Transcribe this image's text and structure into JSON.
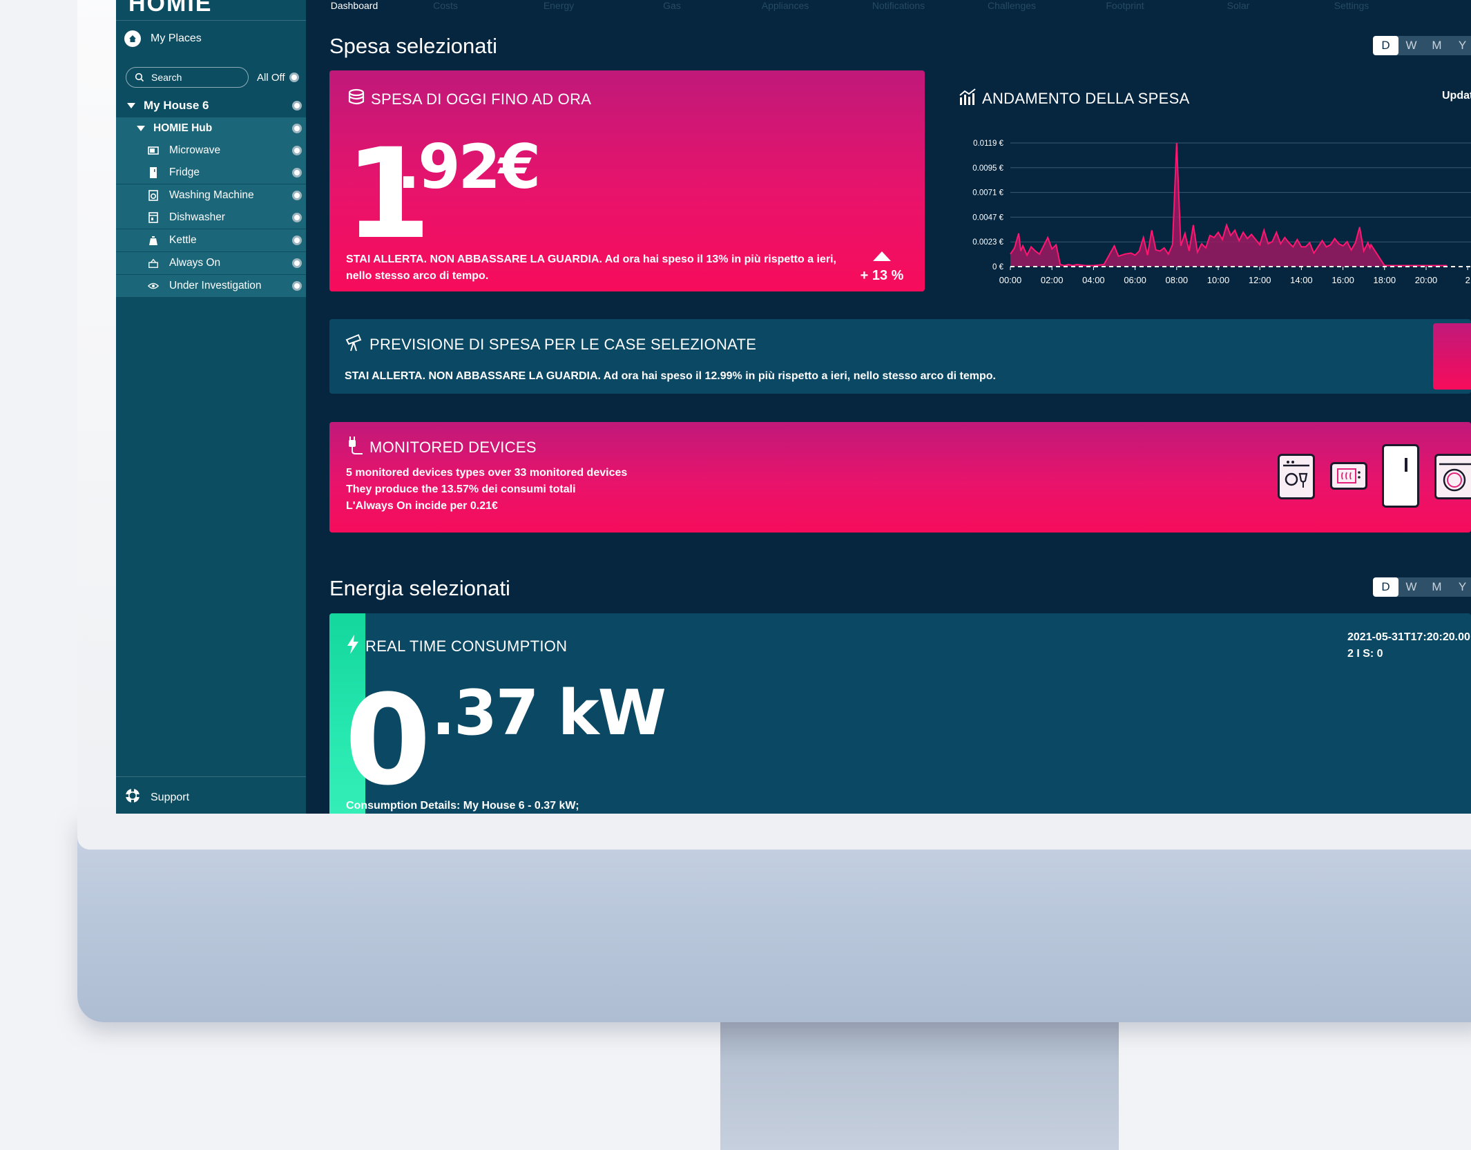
{
  "app": {
    "logo": "HOMIE"
  },
  "sidebar": {
    "my_places": "My Places",
    "search_placeholder": "Search",
    "all_off": "All Off",
    "house": "My House 6",
    "hub": "HOMIE Hub",
    "devices": [
      {
        "label": "Microwave",
        "icon": "microwave-icon"
      },
      {
        "label": "Fridge",
        "icon": "fridge-icon"
      },
      {
        "label": "Washing Machine",
        "icon": "washing-machine-icon"
      },
      {
        "label": "Dishwasher",
        "icon": "dishwasher-icon"
      },
      {
        "label": "Kettle",
        "icon": "kettle-icon"
      },
      {
        "label": "Always On",
        "icon": "always-on-icon"
      },
      {
        "label": "Under Investigation",
        "icon": "eye-icon"
      }
    ],
    "support": "Support"
  },
  "topnav": {
    "tabs": [
      "Dashboard",
      "Costs",
      "Energy",
      "Gas",
      "Appliances",
      "Notifications",
      "Challenges",
      "Footprint",
      "Solar",
      "Settings"
    ],
    "active": "Dashboard"
  },
  "spesa": {
    "section_title": "Spesa selezionati",
    "periods": [
      "D",
      "W",
      "M",
      "Y"
    ],
    "active_period": "D",
    "today": {
      "title": "SPESA DI OGGI FINO AD ORA",
      "value_int": "1",
      "value_dec": ".92€",
      "alert": "STAI ALLERTA. NON ABBASSARE LA GUARDIA. Ad ora hai speso il 13% in più rispetto a ieri, nello stesso arco di tempo.",
      "trend": "+ 13 %"
    },
    "andamento": {
      "title": "ANDAMENTO DELLA SPESA",
      "updated": "Updat"
    },
    "previsione": {
      "title": "PREVISIONE DI SPESA PER LE CASE SELEZIONATE",
      "text": "STAI ALLERTA. NON ABBASSARE LA GUARDIA. Ad ora hai speso il 12.99% in più rispetto a ieri, nello stesso arco di tempo."
    },
    "monitored": {
      "title": "MONITORED DEVICES",
      "lines": [
        "5 monitored devices types over 33 monitored devices",
        "They produce the 13.57% dei consumi totali",
        "L'Always On incide per 0.21€"
      ]
    }
  },
  "energia": {
    "section_title": "Energia selezionati",
    "periods": [
      "D",
      "W",
      "M",
      "Y"
    ],
    "active_period": "D",
    "realtime": {
      "title": "REAL TIME CONSUMPTION",
      "value_int": "0",
      "value_dec": ".37 kW",
      "timestamp": "2021-05-31T17:20:20.00",
      "status": "2 I S: 0",
      "details": "Consumption Details: My House 6 - 0.37 kW;"
    }
  },
  "colors": {
    "accent_pink": "#e8136b",
    "sidebar": "#0c4d62",
    "background": "#062640",
    "teal_card": "#0a4864"
  },
  "chart_data": {
    "type": "area",
    "title": "ANDAMENTO DELLA SPESA",
    "ytick_labels": [
      "0 €",
      "0.0023 €",
      "0.0047 €",
      "0.0071 €",
      "0.0095 €",
      "0.0119 €"
    ],
    "xtick_labels": [
      "00:00",
      "02:00",
      "04:00",
      "06:00",
      "08:00",
      "10:00",
      "12:00",
      "14:00",
      "16:00",
      "18:00",
      "20:00",
      "2"
    ],
    "ylim": [
      0,
      0.0119
    ],
    "x_hours": [
      0,
      0.2,
      0.4,
      0.5,
      0.6,
      0.8,
      1.0,
      1.2,
      1.4,
      1.6,
      1.8,
      2.0,
      2.2,
      2.4,
      2.6,
      2.8,
      3.0,
      3.2,
      3.6,
      4.0,
      4.5,
      5.0,
      5.2,
      5.5,
      5.8,
      6.0,
      6.2,
      6.4,
      6.6,
      6.8,
      7.0,
      7.2,
      7.4,
      7.6,
      7.8,
      8.0,
      8.2,
      8.4,
      8.6,
      8.8,
      9.0,
      9.2,
      9.4,
      9.6,
      9.8,
      10.0,
      10.2,
      10.4,
      10.6,
      10.8,
      11.0,
      11.2,
      11.4,
      11.6,
      11.8,
      12.0,
      12.2,
      12.4,
      12.6,
      12.8,
      13.0,
      13.2,
      13.4,
      13.6,
      13.8,
      14.0,
      14.2,
      14.4,
      14.6,
      14.8,
      15.0,
      15.2,
      15.4,
      15.6,
      15.8,
      16.0,
      16.2,
      16.4,
      16.6,
      16.8,
      17.0,
      17.2,
      17.3,
      17.35,
      18.0,
      20.0,
      21.0
    ],
    "y_values": [
      0.0012,
      0.0018,
      0.0032,
      0.0015,
      0.002,
      0.0011,
      0.0019,
      0.0015,
      0.0012,
      0.002,
      0.0028,
      0.0017,
      0.0021,
      0.0002,
      0.0001,
      0.0002,
      0.0001,
      0.0002,
      0.0001,
      0.0001,
      0.0002,
      0.002,
      0.001,
      0.0012,
      0.0013,
      0.0011,
      0.0015,
      0.0028,
      0.0011,
      0.0035,
      0.0016,
      0.0015,
      0.0018,
      0.0012,
      0.0021,
      0.0119,
      0.002,
      0.0032,
      0.0015,
      0.004,
      0.0014,
      0.0022,
      0.0018,
      0.003,
      0.0028,
      0.0033,
      0.0026,
      0.004,
      0.003,
      0.0035,
      0.0025,
      0.0033,
      0.0027,
      0.0031,
      0.0026,
      0.0021,
      0.0035,
      0.0022,
      0.0024,
      0.0033,
      0.0022,
      0.0028,
      0.0023,
      0.0019,
      0.0026,
      0.0019,
      0.0019,
      0.0023,
      0.0013,
      0.0019,
      0.0025,
      0.0019,
      0.0021,
      0.0027,
      0.0022,
      0.002,
      0.0024,
      0.0016,
      0.0023,
      0.0038,
      0.0015,
      0.0023,
      0.0018,
      0.0021,
      0.0001,
      0.0001,
      0.0001
    ],
    "grid": true
  }
}
